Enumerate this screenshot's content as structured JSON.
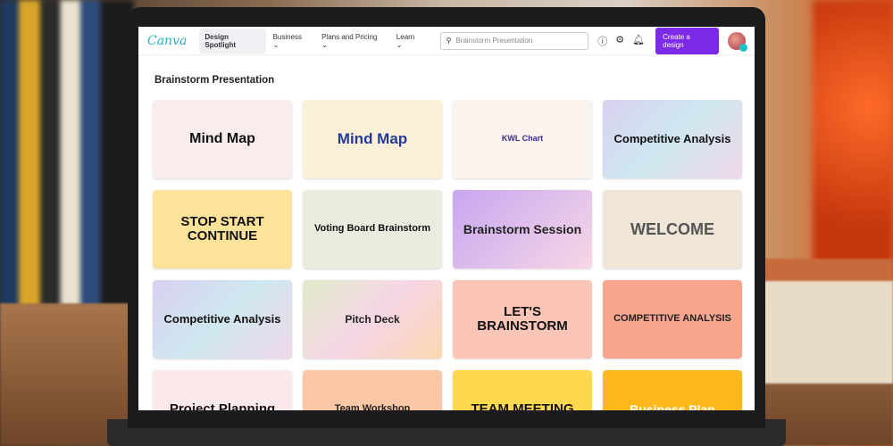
{
  "nav": {
    "logo": "Canva",
    "items": [
      "Design Spotlight",
      "Business",
      "Plans and Pricing",
      "Learn"
    ],
    "search_placeholder": "Brainstorm Presentation",
    "create_label": "Create a design"
  },
  "page_title": "Brainstorm Presentation",
  "cards": [
    {
      "title": "Mind Map",
      "bg": "#f8ecec",
      "color": "#111"
    },
    {
      "title": "Mind Map",
      "bg": "#fdf0d8",
      "color": "#233a9c"
    },
    {
      "title": "KWL Chart",
      "bg": "#fbf3ee",
      "color": "#3a2f8f"
    },
    {
      "title": "Competitive Analysis",
      "bg": "linear-gradient(135deg,#d8d0f0,#cfe8f0,#f0d8ea)",
      "color": "#111"
    },
    {
      "title": "STOP START CONTINUE",
      "bg": "#fde29a",
      "color": "#111"
    },
    {
      "title": "Voting Board Brainstorm",
      "bg": "#ecebe0",
      "color": "#111"
    },
    {
      "title": "Brainstorm Session",
      "bg": "linear-gradient(135deg,#c7a7f0,#f7d6e6)",
      "color": "#222"
    },
    {
      "title": "WELCOME",
      "bg": "#f0e6d8",
      "color": "#555"
    },
    {
      "title": "Competitive Analysis",
      "bg": "linear-gradient(135deg,#d8d0f0,#cfe8f0,#f0d8ea)",
      "color": "#111"
    },
    {
      "title": "Pitch Deck",
      "bg": "linear-gradient(135deg,#dfeac8,#f6d6e6,#fbd7b0)",
      "color": "#222"
    },
    {
      "title": "LET'S BRAINSTORM",
      "bg": "#fbc6b8",
      "color": "#111"
    },
    {
      "title": "COMPETITIVE ANALYSIS",
      "bg": "#f8a58e",
      "color": "#222"
    },
    {
      "title": "Project Planning",
      "bg": "#fbe9ea",
      "color": "#111"
    },
    {
      "title": "Team Workshop",
      "bg": "#fbc7a6",
      "color": "#222"
    },
    {
      "title": "TEAM MEETING",
      "bg": "#ffd84e",
      "color": "#111"
    },
    {
      "title": "Business Plan",
      "bg": "#ffb81c",
      "color": "#fff"
    }
  ]
}
